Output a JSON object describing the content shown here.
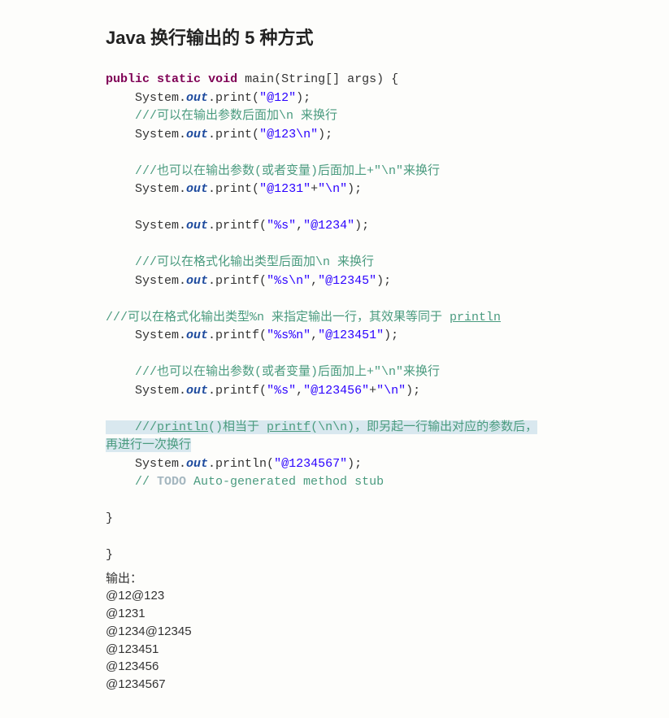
{
  "title": "Java 换行输出的 5 种方式",
  "code": {
    "sig": {
      "kw1": "public",
      "kw2": "static",
      "kw3": "void",
      "name": "main",
      "params": "(String[] args) {"
    },
    "l1": {
      "pre": "    System.",
      "out": "out",
      "post": ".print(",
      "s": "\"@12\"",
      "end": ");"
    },
    "c1": "    ///可以在输出参数后面加\\n 来换行",
    "l2": {
      "pre": "    System.",
      "out": "out",
      "post": ".print(",
      "s": "\"@123\\n\"",
      "end": ");"
    },
    "c2": "    ///也可以在输出参数(或者变量)后面加上+\"\\n\"来换行",
    "l3": {
      "pre": "    System.",
      "out": "out",
      "post": ".print(",
      "s1": "\"@1231\"",
      "plus": "+",
      "s2": "\"\\n\"",
      "end": ");"
    },
    "l4": {
      "pre": "    System.",
      "out": "out",
      "post": ".printf(",
      "s1": "\"%s\"",
      "comma": ",",
      "s2": "\"@1234\"",
      "end": ");"
    },
    "c3": "    ///可以在格式化输出类型后面加\\n 来换行",
    "l5": {
      "pre": "    System.",
      "out": "out",
      "post": ".printf(",
      "s1": "\"%s\\n\"",
      "comma": ",",
      "s2": "\"@12345\"",
      "end": ");"
    },
    "c4": {
      "pre": "///可以在格式化输出类型%n 来指定输出一行，其效果等同于 ",
      "u": "println"
    },
    "l6": {
      "pre": "    System.",
      "out": "out",
      "post": ".printf(",
      "s1": "\"%s%n\"",
      "comma": ",",
      "s2": "\"@123451\"",
      "end": ");"
    },
    "c5": "    ///也可以在输出参数(或者变量)后面加上+\"\\n\"来换行",
    "l7": {
      "pre": "    System.",
      "out": "out",
      "post": ".printf(",
      "s1": "\"%s\"",
      "comma": ",",
      "s2": "\"@123456\"",
      "plus": "+",
      "s3": "\"\\n\"",
      "end": ");"
    },
    "c6": {
      "p1": "    ///",
      "u1": "println",
      "p2": "()相当于 ",
      "u2": "printf",
      "p3": "(\\n\\n)，即另起一行输出对应的参数后，",
      "p4": "再进行一次换行"
    },
    "l8": {
      "pre": "    System.",
      "out": "out",
      "post": ".println(",
      "s": "\"@1234567\"",
      "end": ");"
    },
    "todo": {
      "pre": "    // ",
      "kw": "TODO",
      "post": " Auto-generated method stub"
    },
    "close1": "}",
    "close2": "}"
  },
  "output": {
    "label": "输出：",
    "o1": "@12@123",
    "o2": "@1231",
    "o3": "@1234@12345",
    "o4": "@123451",
    "o5": "@123456",
    "o6": "@1234567"
  }
}
